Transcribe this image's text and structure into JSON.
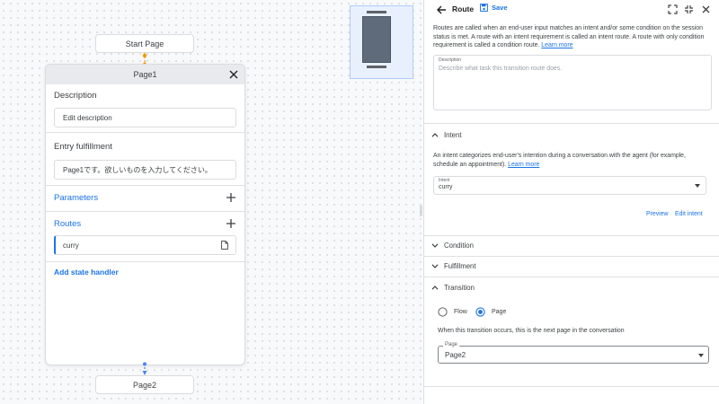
{
  "canvas": {
    "start_node": "Start Page",
    "page_card": {
      "title": "Page1",
      "description_label": "Description",
      "description_value": "Edit description",
      "entry_label": "Entry fulfillment",
      "entry_value": "Page1です。欲しいものを入力してください。",
      "parameters_label": "Parameters",
      "routes_label": "Routes",
      "route_item": "curry",
      "add_state_handler": "Add state handler"
    },
    "end_node": "Page2"
  },
  "panel": {
    "title": "Route",
    "save_label": "Save",
    "intro_text": "Routes are called when an end-user input matches an intent and/or some condition on the session status is met. A route with an intent requirement is called an intent route. A route with only condition requirement is called a condition route.",
    "intro_link": "Learn more",
    "description_label": "Description",
    "description_placeholder": "Describe what task this transition route does.",
    "intent": {
      "header": "Intent",
      "text": "An intent categorizes end-user's intention during a conversation with the agent (for example, schedule an appointment).",
      "link": "Learn more",
      "select_label": "Intent",
      "select_value": "curry",
      "preview_label": "Preview",
      "edit_label": "Edit intent"
    },
    "condition_header": "Condition",
    "fulfillment_header": "Fulfillment",
    "transition": {
      "header": "Transition",
      "option_flow": "Flow",
      "option_page": "Page",
      "selected": "Page",
      "note": "When this transition occurs, this is the next page in the conversation",
      "select_label": "Page",
      "select_value": "Page2"
    }
  },
  "colors": {
    "accent": "#1a73e8",
    "connector_top": "#f29900",
    "connector_bottom": "#4285f4"
  }
}
